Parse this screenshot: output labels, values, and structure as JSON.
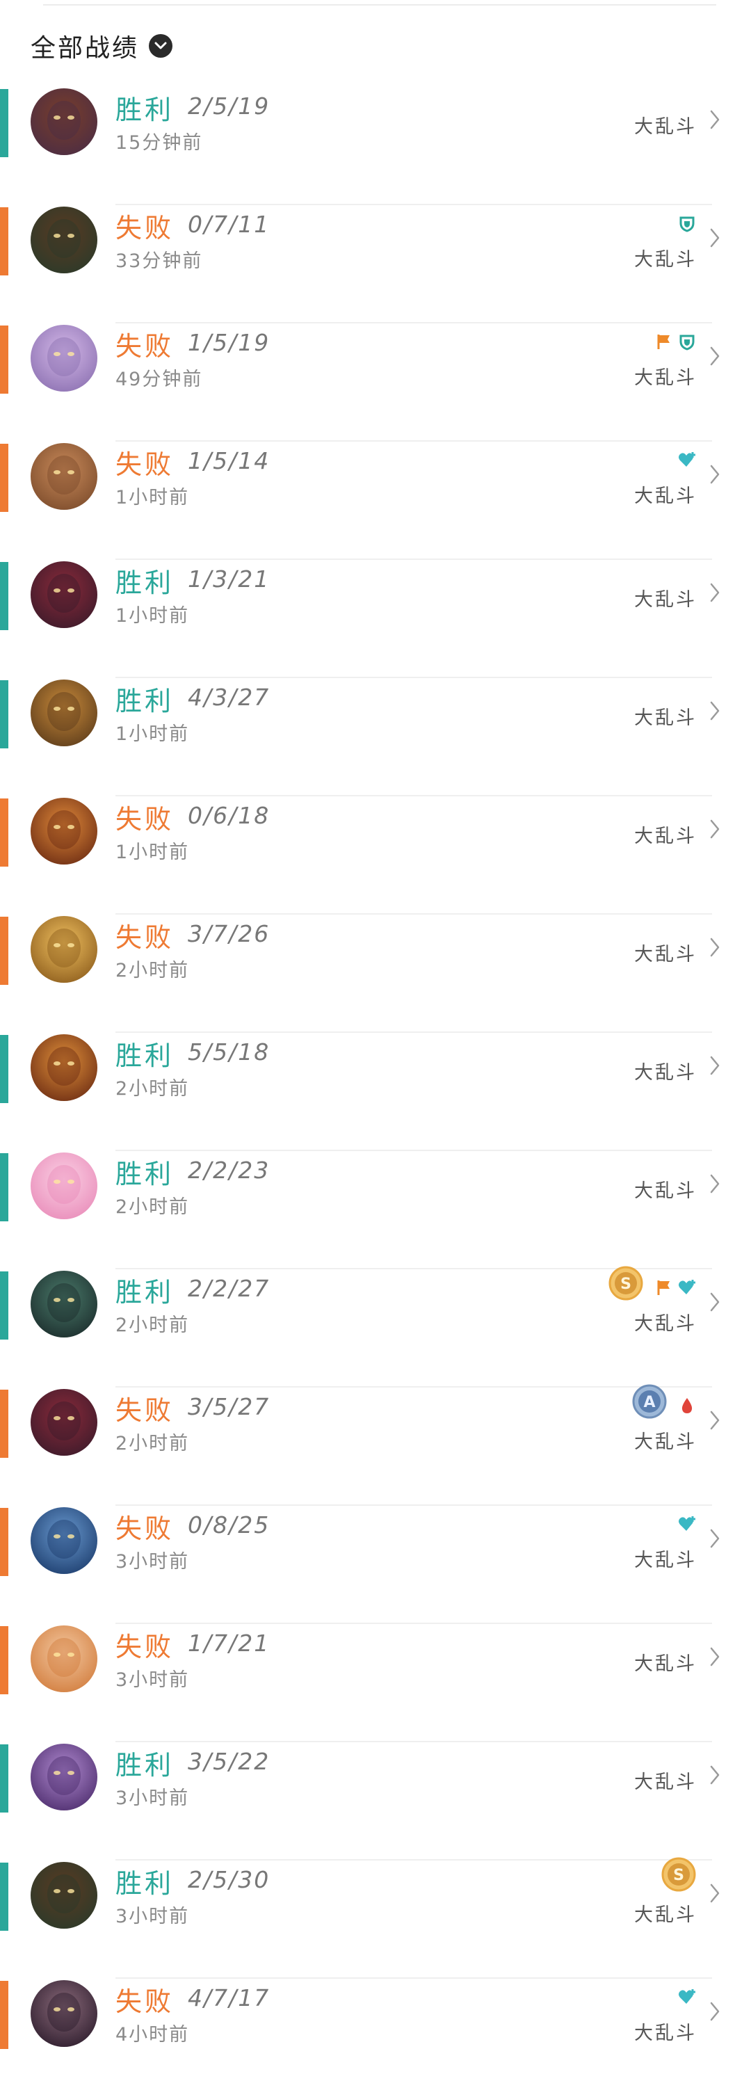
{
  "header": {
    "title": "全部战绩"
  },
  "colors": {
    "win": "#2aa79a",
    "loss": "#ee7a33"
  },
  "matches": [
    {
      "result": "胜利",
      "outcome": "win",
      "kda": "2/5/19",
      "time": "15分钟前",
      "mode": "大乱斗",
      "badges": [],
      "medal": null,
      "avatar": [
        "#4a2c44",
        "#7a3e2a"
      ]
    },
    {
      "result": "失败",
      "outcome": "loss",
      "kda": "0/7/11",
      "time": "33分钟前",
      "mode": "大乱斗",
      "badges": [
        "shield-icon"
      ],
      "medal": null,
      "avatar": [
        "#2a3a2a",
        "#5a3a22"
      ]
    },
    {
      "result": "失败",
      "outcome": "loss",
      "kda": "1/5/19",
      "time": "49分钟前",
      "mode": "大乱斗",
      "badges": [
        "flag-icon",
        "shield-icon"
      ],
      "medal": null,
      "avatar": [
        "#8a6fb0",
        "#d4b8e8"
      ]
    },
    {
      "result": "失败",
      "outcome": "loss",
      "kda": "1/5/14",
      "time": "1小时前",
      "mode": "大乱斗",
      "badges": [
        "heart-plus-icon"
      ],
      "medal": null,
      "avatar": [
        "#7a4a2a",
        "#c98a5a"
      ]
    },
    {
      "result": "胜利",
      "outcome": "win",
      "kda": "1/3/21",
      "time": "1小时前",
      "mode": "大乱斗",
      "badges": [],
      "medal": null,
      "avatar": [
        "#3a1a2a",
        "#8a2a3a"
      ]
    },
    {
      "result": "胜利",
      "outcome": "win",
      "kda": "4/3/27",
      "time": "1小时前",
      "mode": "大乱斗",
      "badges": [],
      "medal": null,
      "avatar": [
        "#5a3a1a",
        "#c88a3a"
      ]
    },
    {
      "result": "失败",
      "outcome": "loss",
      "kda": "0/6/18",
      "time": "1小时前",
      "mode": "大乱斗",
      "badges": [],
      "medal": null,
      "avatar": [
        "#6a2a12",
        "#e08a3a"
      ]
    },
    {
      "result": "失败",
      "outcome": "loss",
      "kda": "3/7/26",
      "time": "2小时前",
      "mode": "大乱斗",
      "badges": [],
      "medal": null,
      "avatar": [
        "#8a5a1a",
        "#f0c060"
      ]
    },
    {
      "result": "胜利",
      "outcome": "win",
      "kda": "5/5/18",
      "time": "2小时前",
      "mode": "大乱斗",
      "badges": [],
      "medal": null,
      "avatar": [
        "#6a2a12",
        "#e0903a"
      ]
    },
    {
      "result": "胜利",
      "outcome": "win",
      "kda": "2/2/23",
      "time": "2小时前",
      "mode": "大乱斗",
      "badges": [],
      "medal": null,
      "avatar": [
        "#e88ab8",
        "#fbd0e4"
      ]
    },
    {
      "result": "胜利",
      "outcome": "win",
      "kda": "2/2/27",
      "time": "2小时前",
      "mode": "大乱斗",
      "badges": [
        "flag-icon",
        "heart-plus-icon"
      ],
      "medal": "S",
      "avatar": [
        "#1a2a2a",
        "#4a7a6a"
      ]
    },
    {
      "result": "失败",
      "outcome": "loss",
      "kda": "3/5/27",
      "time": "2小时前",
      "mode": "大乱斗",
      "badges": [
        "blood-drop-icon"
      ],
      "medal": "A",
      "avatar": [
        "#3a1a2a",
        "#8a2a3a"
      ]
    },
    {
      "result": "失败",
      "outcome": "loss",
      "kda": "0/8/25",
      "time": "3小时前",
      "mode": "大乱斗",
      "badges": [
        "heart-plus-icon"
      ],
      "medal": null,
      "avatar": [
        "#1a3a6a",
        "#6a9ad0"
      ]
    },
    {
      "result": "失败",
      "outcome": "loss",
      "kda": "1/7/21",
      "time": "3小时前",
      "mode": "大乱斗",
      "badges": [],
      "medal": null,
      "avatar": [
        "#d07a3a",
        "#f4c8a0"
      ]
    },
    {
      "result": "胜利",
      "outcome": "win",
      "kda": "3/5/22",
      "time": "3小时前",
      "mode": "大乱斗",
      "badges": [],
      "medal": null,
      "avatar": [
        "#4a2a6a",
        "#b08ad0"
      ]
    },
    {
      "result": "胜利",
      "outcome": "win",
      "kda": "2/5/30",
      "time": "3小时前",
      "mode": "大乱斗",
      "badges": [],
      "medal": "S",
      "avatar": [
        "#2a3a2a",
        "#5a3a22"
      ]
    },
    {
      "result": "失败",
      "outcome": "loss",
      "kda": "4/7/17",
      "time": "4小时前",
      "mode": "大乱斗",
      "badges": [
        "heart-plus-icon"
      ],
      "medal": null,
      "avatar": [
        "#2a1a2a",
        "#8a6a7a"
      ]
    }
  ]
}
